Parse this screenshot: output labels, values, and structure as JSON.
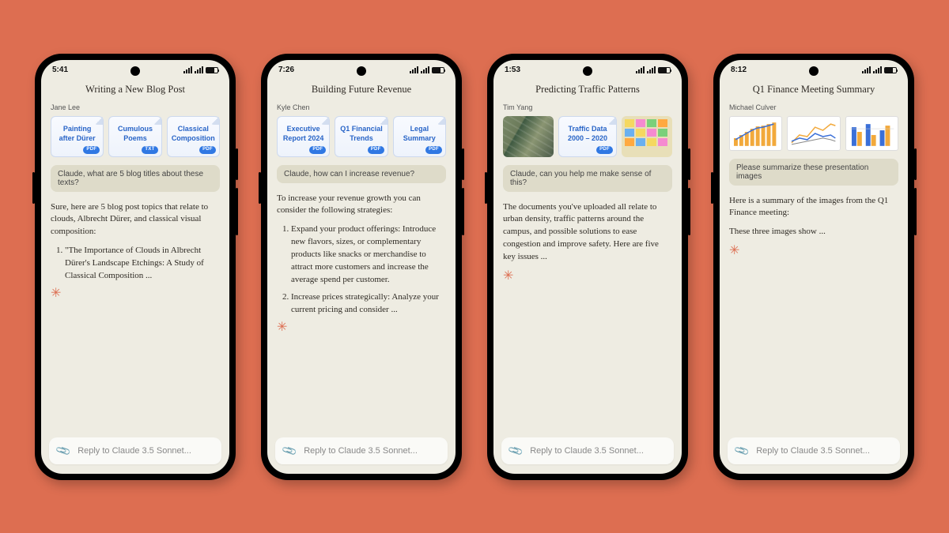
{
  "reply_placeholder": "Reply to Claude 3.5 Sonnet...",
  "phones": [
    {
      "time": "5:41",
      "title": "Writing a New Blog Post",
      "user": "Jane Lee",
      "attachments": [
        {
          "kind": "file",
          "title": "Painting after Dürer",
          "badge": "PDF"
        },
        {
          "kind": "file",
          "title": "Cumulous Poems",
          "badge": "TXT"
        },
        {
          "kind": "file",
          "title": "Classical Composition",
          "badge": "PDF"
        }
      ],
      "prompt": "Claude, what are 5 blog titles about these texts?",
      "response_intro": "Sure, here are 5 blog post topics that relate to clouds, Albrecht Dürer, and classical visual composition:",
      "response_list": [
        "\"The Importance of Clouds in Albrecht Dürer's Landscape Etchings: A Study of Classical Composition ..."
      ]
    },
    {
      "time": "7:26",
      "title": "Building Future Revenue",
      "user": "Kyle Chen",
      "attachments": [
        {
          "kind": "file",
          "title": "Executive Report 2024",
          "badge": "PDF"
        },
        {
          "kind": "file",
          "title": "Q1 Financial Trends",
          "badge": "PDF"
        },
        {
          "kind": "file",
          "title": "Legal Summary",
          "badge": "PDF"
        }
      ],
      "prompt": "Claude, how can I increase revenue?",
      "response_intro": "To increase your revenue growth you can consider the following strategies:",
      "response_list": [
        "Expand your product offerings: Introduce new flavors, sizes, or complementary products like snacks or merchandise to attract more customers and increase the average spend per customer.",
        "Increase prices strategically: Analyze your current pricing and consider ..."
      ]
    },
    {
      "time": "1:53",
      "title": "Predicting Traffic Patterns",
      "user": "Tim Yang",
      "attachments": [
        {
          "kind": "image",
          "variant": "aerial"
        },
        {
          "kind": "file",
          "title": "Traffic Data 2000 – 2020",
          "badge": "PDF"
        },
        {
          "kind": "image",
          "variant": "stickies"
        }
      ],
      "prompt": "Claude, can you help me make sense of this?",
      "response_intro": "The documents you've uploaded all relate to urban density, traffic patterns around the campus, and possible solutions to ease congestion and improve safety. Here are five key issues ...",
      "response_list": []
    },
    {
      "time": "8:12",
      "title": "Q1 Finance Meeting Summary",
      "user": "Michael Culver",
      "attachments": [
        {
          "kind": "chart",
          "variant": "bars"
        },
        {
          "kind": "chart",
          "variant": "lines"
        },
        {
          "kind": "chart",
          "variant": "grouped"
        }
      ],
      "prompt": "Please summarize these presentation images",
      "response_intro": "Here is a summary of the images from the Q1 Finance meeting:",
      "response_extra": "These three images show ...",
      "response_list": []
    }
  ]
}
